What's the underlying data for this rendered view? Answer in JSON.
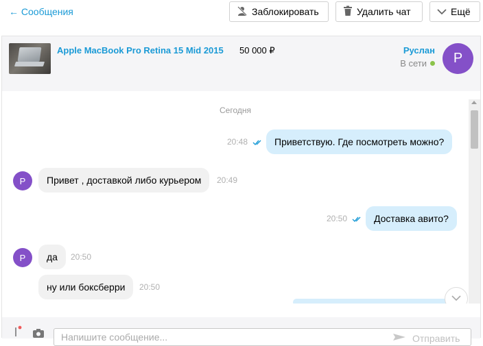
{
  "topbar": {
    "back_label": "← Сообщения",
    "block_label": "Заблокировать",
    "delete_label": "Удалить чат",
    "more_label": "Ещё"
  },
  "header": {
    "product_title": "Apple MacBook Pro Retina 15 Mid 2015",
    "price": "50 000 ₽",
    "user_name": "Руслан",
    "user_status": "В сети",
    "avatar_letter": "Р"
  },
  "messages": {
    "date_separator": "Сегодня",
    "items": [
      {
        "direction": "out",
        "text": "Приветствую. Где посмотреть можно?",
        "time": "20:48",
        "read": true
      },
      {
        "direction": "in",
        "text": "Привет , доставкой либо курьером",
        "time": "20:49",
        "avatar_letter": "Р"
      },
      {
        "direction": "out",
        "text": "Доставка авито?",
        "time": "20:50",
        "read": true
      },
      {
        "direction": "in",
        "text": "да",
        "time": "20:50",
        "avatar_letter": "Р"
      },
      {
        "direction": "in",
        "text": "ну или боксберри",
        "time": "20:50"
      }
    ]
  },
  "composer": {
    "placeholder": "Напишите сообщение...",
    "send_label": "Отправить"
  },
  "colors": {
    "accent": "#1a9ad6",
    "avatar": "#8450c8",
    "outgoing_bubble": "#d6eefc",
    "incoming_bubble": "#f1f1f1",
    "online": "#8bc34a"
  },
  "icons": {
    "block": "block-user-icon",
    "delete": "trash-icon",
    "more": "chevron-down-icon",
    "read": "double-check-icon",
    "attach": "paperclip-icon",
    "camera": "camera-icon",
    "send": "send-icon",
    "scroll": "scroll-down-icon"
  }
}
